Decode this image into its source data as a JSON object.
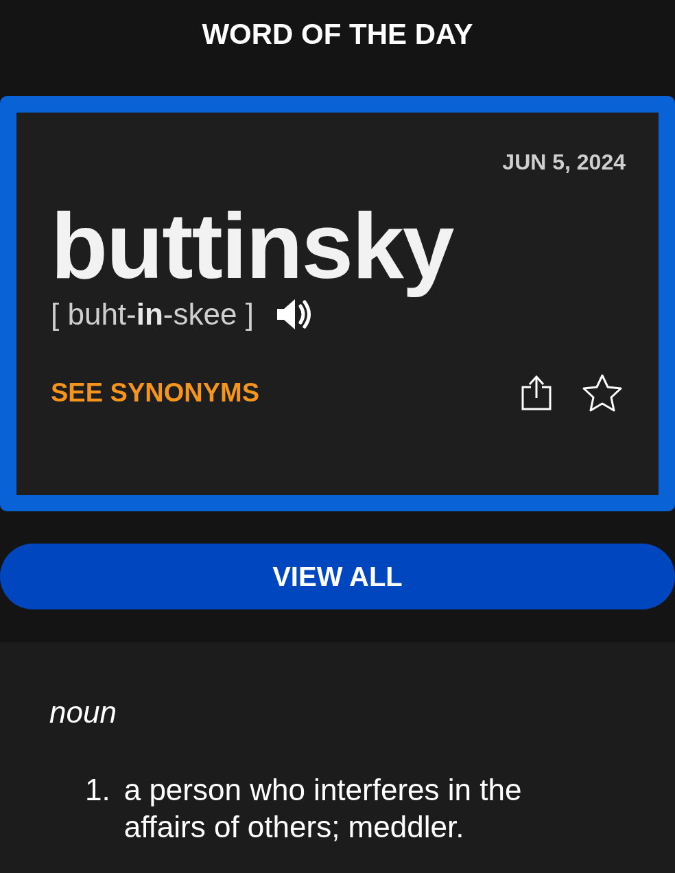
{
  "header": {
    "title": "WORD OF THE DAY"
  },
  "card": {
    "date": "JUN 5, 2024",
    "word": "buttinsky",
    "pronunciation": "[ buht-**in**-skee ]",
    "synonyms_link": "SEE SYNONYMS"
  },
  "view_all_button": "VIEW ALL",
  "definition": {
    "part_of_speech": "noun",
    "senses": [
      {
        "number": "1.",
        "text": "a person who interferes in the affairs of others; meddler."
      }
    ]
  }
}
